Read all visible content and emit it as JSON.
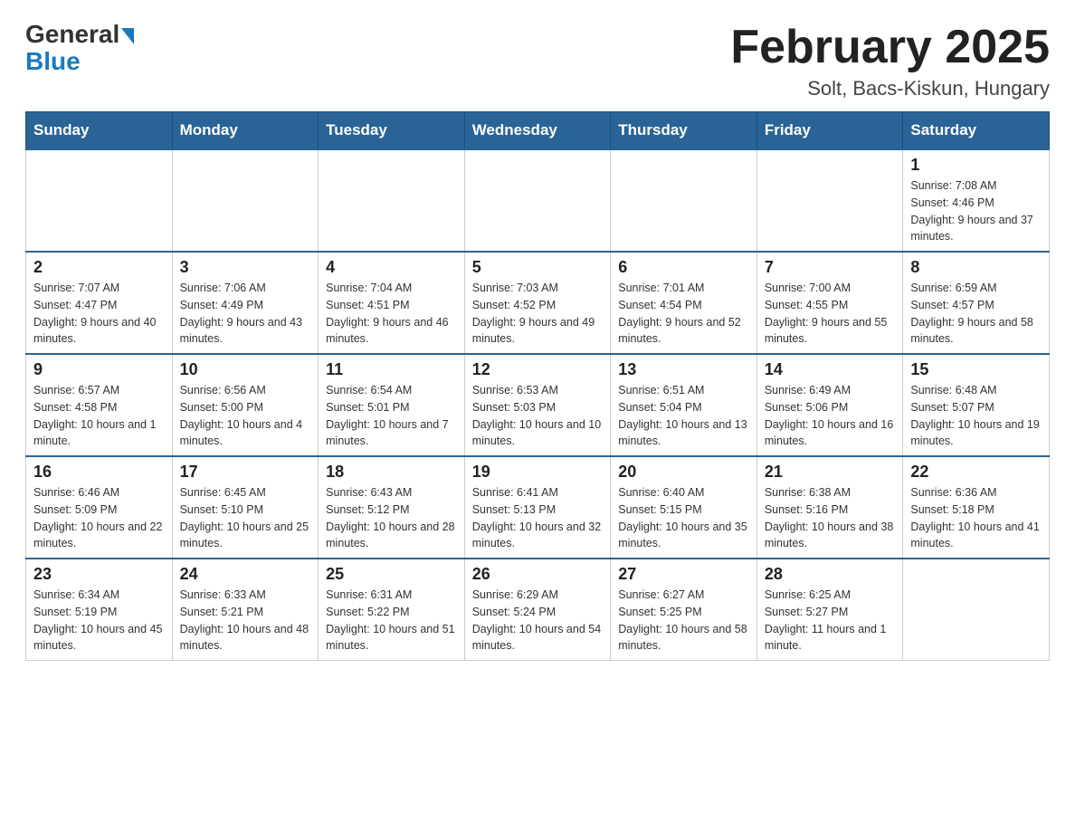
{
  "logo": {
    "general": "General",
    "blue": "Blue"
  },
  "header": {
    "month_title": "February 2025",
    "location": "Solt, Bacs-Kiskun, Hungary"
  },
  "days_of_week": [
    "Sunday",
    "Monday",
    "Tuesday",
    "Wednesday",
    "Thursday",
    "Friday",
    "Saturday"
  ],
  "weeks": [
    [
      {
        "day": "",
        "info": ""
      },
      {
        "day": "",
        "info": ""
      },
      {
        "day": "",
        "info": ""
      },
      {
        "day": "",
        "info": ""
      },
      {
        "day": "",
        "info": ""
      },
      {
        "day": "",
        "info": ""
      },
      {
        "day": "1",
        "info": "Sunrise: 7:08 AM\nSunset: 4:46 PM\nDaylight: 9 hours and 37 minutes."
      }
    ],
    [
      {
        "day": "2",
        "info": "Sunrise: 7:07 AM\nSunset: 4:47 PM\nDaylight: 9 hours and 40 minutes."
      },
      {
        "day": "3",
        "info": "Sunrise: 7:06 AM\nSunset: 4:49 PM\nDaylight: 9 hours and 43 minutes."
      },
      {
        "day": "4",
        "info": "Sunrise: 7:04 AM\nSunset: 4:51 PM\nDaylight: 9 hours and 46 minutes."
      },
      {
        "day": "5",
        "info": "Sunrise: 7:03 AM\nSunset: 4:52 PM\nDaylight: 9 hours and 49 minutes."
      },
      {
        "day": "6",
        "info": "Sunrise: 7:01 AM\nSunset: 4:54 PM\nDaylight: 9 hours and 52 minutes."
      },
      {
        "day": "7",
        "info": "Sunrise: 7:00 AM\nSunset: 4:55 PM\nDaylight: 9 hours and 55 minutes."
      },
      {
        "day": "8",
        "info": "Sunrise: 6:59 AM\nSunset: 4:57 PM\nDaylight: 9 hours and 58 minutes."
      }
    ],
    [
      {
        "day": "9",
        "info": "Sunrise: 6:57 AM\nSunset: 4:58 PM\nDaylight: 10 hours and 1 minute."
      },
      {
        "day": "10",
        "info": "Sunrise: 6:56 AM\nSunset: 5:00 PM\nDaylight: 10 hours and 4 minutes."
      },
      {
        "day": "11",
        "info": "Sunrise: 6:54 AM\nSunset: 5:01 PM\nDaylight: 10 hours and 7 minutes."
      },
      {
        "day": "12",
        "info": "Sunrise: 6:53 AM\nSunset: 5:03 PM\nDaylight: 10 hours and 10 minutes."
      },
      {
        "day": "13",
        "info": "Sunrise: 6:51 AM\nSunset: 5:04 PM\nDaylight: 10 hours and 13 minutes."
      },
      {
        "day": "14",
        "info": "Sunrise: 6:49 AM\nSunset: 5:06 PM\nDaylight: 10 hours and 16 minutes."
      },
      {
        "day": "15",
        "info": "Sunrise: 6:48 AM\nSunset: 5:07 PM\nDaylight: 10 hours and 19 minutes."
      }
    ],
    [
      {
        "day": "16",
        "info": "Sunrise: 6:46 AM\nSunset: 5:09 PM\nDaylight: 10 hours and 22 minutes."
      },
      {
        "day": "17",
        "info": "Sunrise: 6:45 AM\nSunset: 5:10 PM\nDaylight: 10 hours and 25 minutes."
      },
      {
        "day": "18",
        "info": "Sunrise: 6:43 AM\nSunset: 5:12 PM\nDaylight: 10 hours and 28 minutes."
      },
      {
        "day": "19",
        "info": "Sunrise: 6:41 AM\nSunset: 5:13 PM\nDaylight: 10 hours and 32 minutes."
      },
      {
        "day": "20",
        "info": "Sunrise: 6:40 AM\nSunset: 5:15 PM\nDaylight: 10 hours and 35 minutes."
      },
      {
        "day": "21",
        "info": "Sunrise: 6:38 AM\nSunset: 5:16 PM\nDaylight: 10 hours and 38 minutes."
      },
      {
        "day": "22",
        "info": "Sunrise: 6:36 AM\nSunset: 5:18 PM\nDaylight: 10 hours and 41 minutes."
      }
    ],
    [
      {
        "day": "23",
        "info": "Sunrise: 6:34 AM\nSunset: 5:19 PM\nDaylight: 10 hours and 45 minutes."
      },
      {
        "day": "24",
        "info": "Sunrise: 6:33 AM\nSunset: 5:21 PM\nDaylight: 10 hours and 48 minutes."
      },
      {
        "day": "25",
        "info": "Sunrise: 6:31 AM\nSunset: 5:22 PM\nDaylight: 10 hours and 51 minutes."
      },
      {
        "day": "26",
        "info": "Sunrise: 6:29 AM\nSunset: 5:24 PM\nDaylight: 10 hours and 54 minutes."
      },
      {
        "day": "27",
        "info": "Sunrise: 6:27 AM\nSunset: 5:25 PM\nDaylight: 10 hours and 58 minutes."
      },
      {
        "day": "28",
        "info": "Sunrise: 6:25 AM\nSunset: 5:27 PM\nDaylight: 11 hours and 1 minute."
      },
      {
        "day": "",
        "info": ""
      }
    ]
  ]
}
